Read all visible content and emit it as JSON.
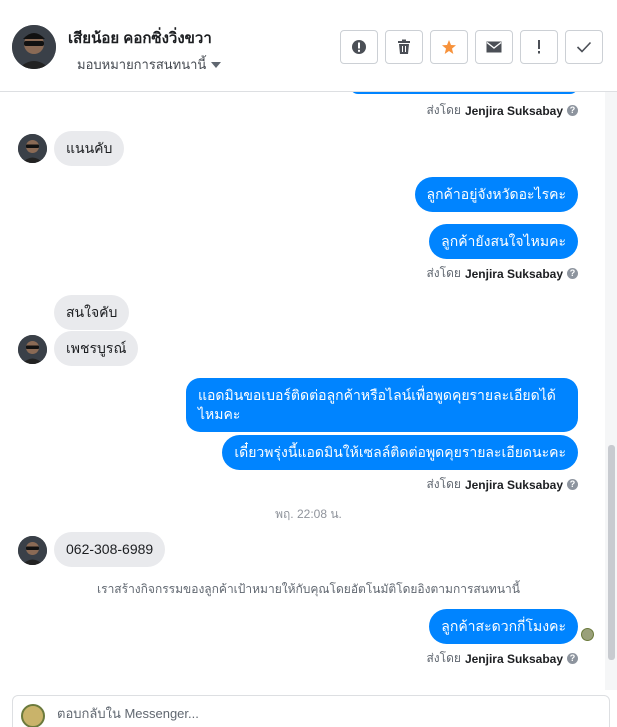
{
  "header": {
    "name": "เสียน้อย คอกซิ่งวิ่งขวา",
    "assign_label": "มอบหมายการสนทนานี้",
    "actions": [
      {
        "icon": "exclamation-circle-icon"
      },
      {
        "icon": "trash-icon"
      },
      {
        "icon": "star-icon"
      },
      {
        "icon": "envelope-icon"
      },
      {
        "icon": "exclamation-icon"
      },
      {
        "icon": "check-icon"
      }
    ],
    "star_color": "#f7923b"
  },
  "thread": {
    "sent_by_prefix": "ส่งโดย",
    "agent_name": "Jenjira Suksabay",
    "messages": {
      "m1": "แนนคับ",
      "m2": "ลูกค้าอยู่จังหวัดอะไรคะ",
      "m3": "ลูกค้ายังสนใจไหมคะ",
      "m4": "สนใจคับ",
      "m5": "เพชรบูรณ์",
      "m6_line1": "แอดมินขอเบอร์ติดต่อลูกค้าหรือไลน์เพื่อพูดคุยรายละเอียดได้",
      "m6_line2": "ไหมคะ",
      "m7": "เดี๋ยวพรุ่งนี้แอดมินให้เซลล์ติดต่อพูดคุยรายละเอียดนะคะ",
      "m8": "062-308-6989",
      "m9": "ลูกค้าสะดวกกี่โมงคะ"
    },
    "timestamp": "พฤ. 22:08 น.",
    "system_message": "เราสร้างกิจกรรมของลูกค้าเป้าหมายให้กับคุณโดยอัตโนมัติโดยอิงตามการสนทนานี้"
  },
  "composer": {
    "placeholder": "ตอบกลับใน Messenger..."
  },
  "colors": {
    "outgoing_bubble": "#0084ff",
    "incoming_bubble": "#e9eaed"
  }
}
